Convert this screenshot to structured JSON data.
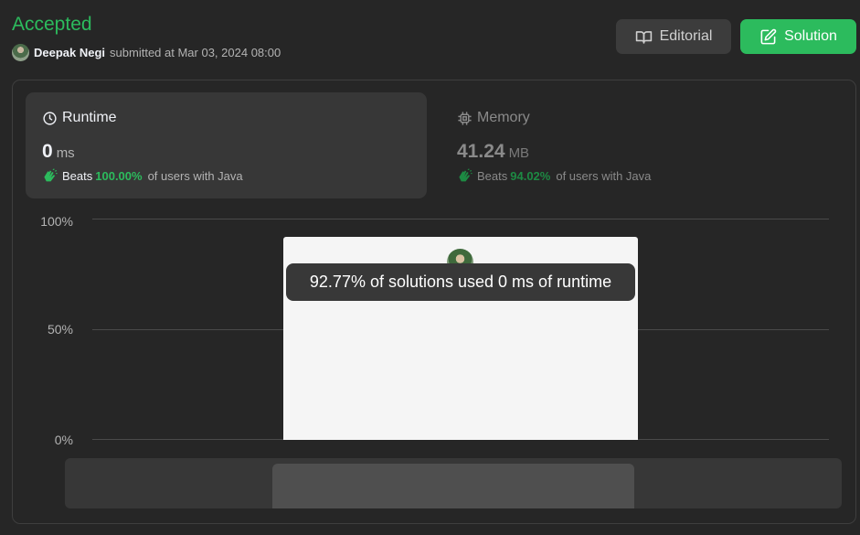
{
  "status": "Accepted",
  "submission": {
    "user": "Deepak Negi",
    "submitted_text": "submitted at Mar 03, 2024 08:00"
  },
  "buttons": {
    "editorial": "Editorial",
    "solution": "Solution"
  },
  "runtime": {
    "title": "Runtime",
    "value": "0",
    "unit": "ms",
    "beats_label": "Beats",
    "beats_pct": "100.00%",
    "beats_rest": "of users with Java"
  },
  "memory": {
    "title": "Memory",
    "value": "41.24",
    "unit": "MB",
    "beats_label": "Beats",
    "beats_pct": "94.02%",
    "beats_rest": "of users with Java"
  },
  "chart": {
    "y_labels": [
      "100%",
      "50%",
      "0%"
    ],
    "tooltip": "92.77% of solutions used 0 ms of runtime"
  },
  "colors": {
    "accent_green": "#2cbb5d",
    "background": "#262626"
  }
}
